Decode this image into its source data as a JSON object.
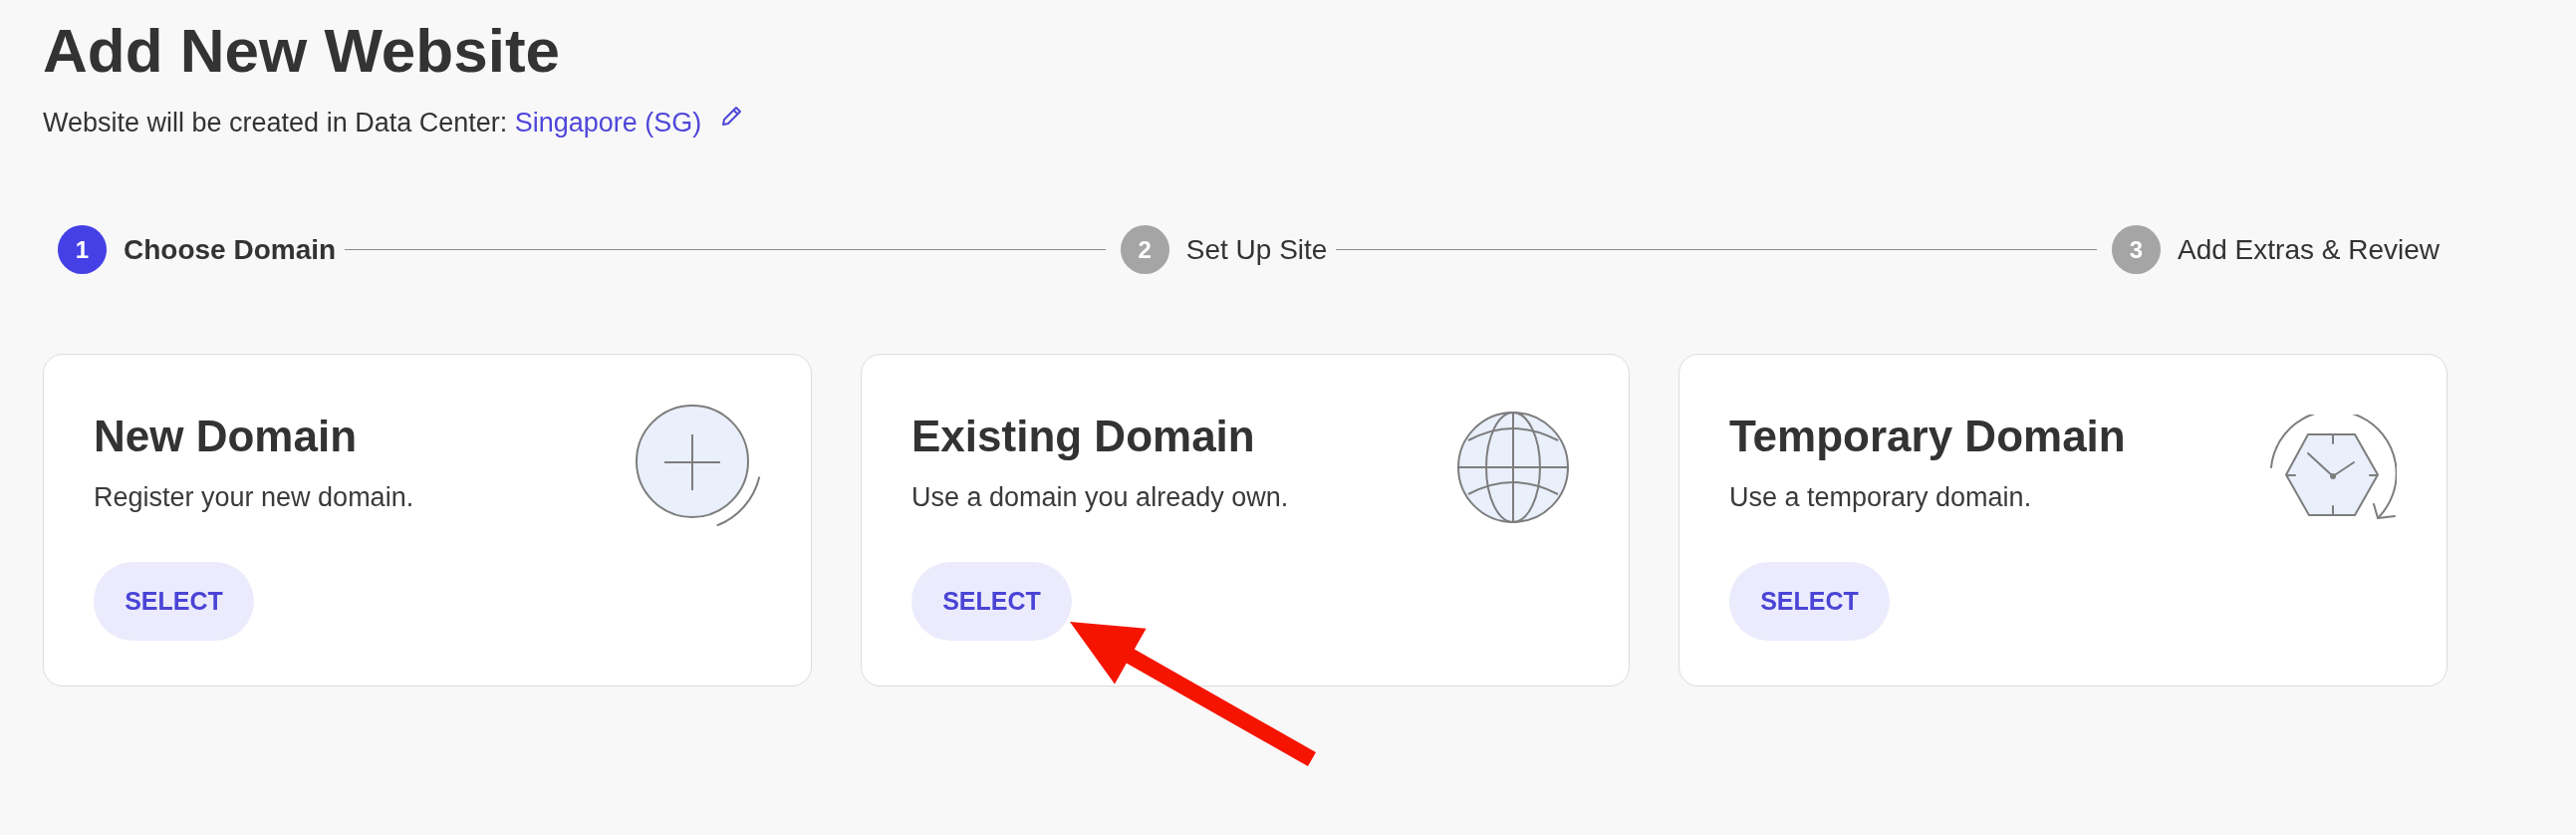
{
  "header": {
    "title": "Add New Website",
    "subtitle": "Website will be created in Data Center:",
    "data_center": "Singapore (SG)"
  },
  "steps": [
    {
      "number": "1",
      "label": "Choose Domain",
      "current": true
    },
    {
      "number": "2",
      "label": "Set Up Site",
      "current": false
    },
    {
      "number": "3",
      "label": "Add Extras & Review",
      "current": false
    }
  ],
  "cards": [
    {
      "kind": "new",
      "title": "New Domain",
      "description": "Register your new domain.",
      "button": "SELECT",
      "annotated": false
    },
    {
      "kind": "existing",
      "title": "Existing Domain",
      "description": "Use a domain you already own.",
      "button": "SELECT",
      "annotated": true
    },
    {
      "kind": "temporary",
      "title": "Temporary Domain",
      "description": "Use a temporary domain.",
      "button": "SELECT",
      "annotated": false
    }
  ]
}
